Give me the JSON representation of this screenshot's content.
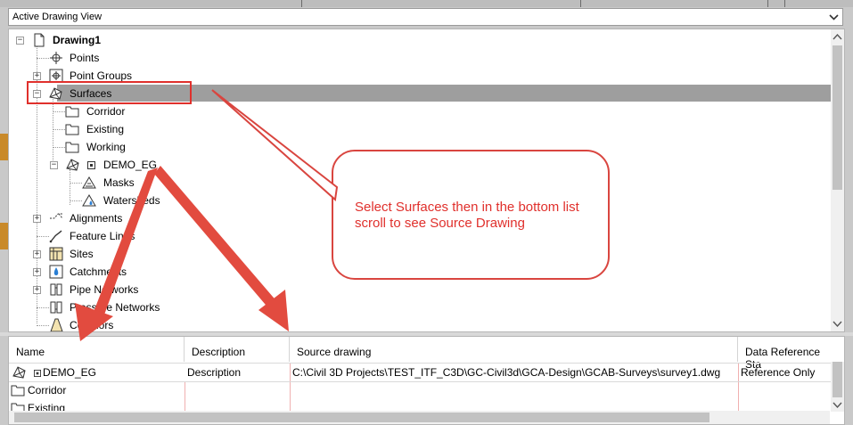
{
  "panel_selector": {
    "label": "Active Drawing View"
  },
  "tree": {
    "root": "Drawing1",
    "items": [
      {
        "label": "Points"
      },
      {
        "label": "Point Groups"
      },
      {
        "label": "Surfaces"
      },
      {
        "label": "Corridor"
      },
      {
        "label": "Existing"
      },
      {
        "label": "Working"
      },
      {
        "label": "DEMO_EG"
      },
      {
        "label": "Masks"
      },
      {
        "label": "Watersheds"
      },
      {
        "label": "Alignments"
      },
      {
        "label": "Feature Lines"
      },
      {
        "label": "Sites"
      },
      {
        "label": "Catchments"
      },
      {
        "label": "Pipe Networks"
      },
      {
        "label": "Pressure Networks"
      },
      {
        "label": "Corridors"
      }
    ]
  },
  "list": {
    "columns": [
      "Name",
      "Description",
      "Source drawing",
      "Data Reference Sta"
    ],
    "rows": [
      {
        "name": "DEMO_EG",
        "description": "Description",
        "source": "C:\\Civil 3D Projects\\TEST_ITF_C3D\\GC-Civil3d\\GCA-Design\\GCAB-Surveys\\survey1.dwg",
        "status": "Reference Only"
      },
      {
        "name": "Corridor"
      },
      {
        "name": "Existing"
      }
    ]
  },
  "callout": {
    "text": "Select Surfaces then in the bottom list scroll to see Source Drawing"
  },
  "colors": {
    "annotation": "#e0302c",
    "selection": "#9e9e9e"
  }
}
